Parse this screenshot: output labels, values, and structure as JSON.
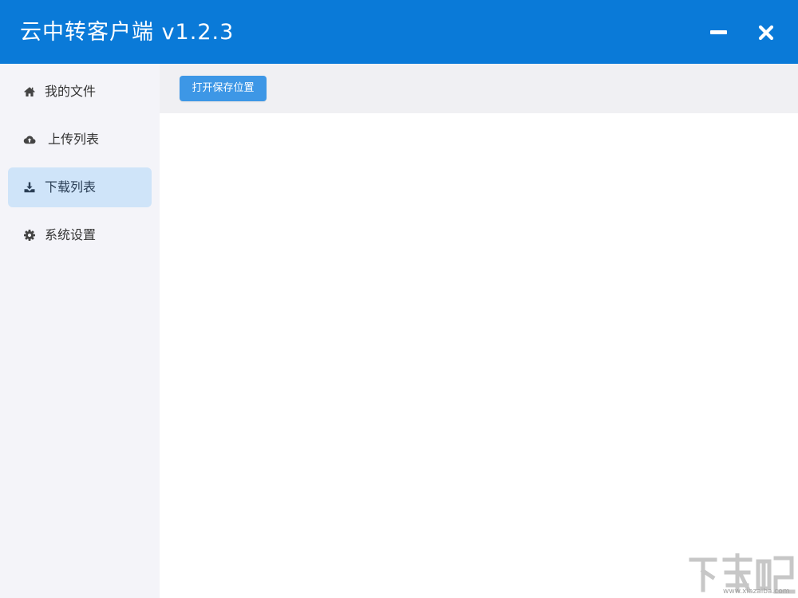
{
  "window": {
    "title": "云中转客户端 v1.2.3",
    "minimize_icon": "minimize-icon",
    "close_icon": "close-icon",
    "accent_color": "#0a7ad8"
  },
  "sidebar": {
    "items": [
      {
        "label": "我的文件",
        "icon": "home-icon",
        "active": false
      },
      {
        "label": "上传列表",
        "icon": "cloud-upload-icon",
        "active": false
      },
      {
        "label": "下载列表",
        "icon": "download-icon",
        "active": true
      },
      {
        "label": "系统设置",
        "icon": "gear-icon",
        "active": false
      }
    ]
  },
  "toolbar": {
    "open_location_label": "打开保存位置"
  },
  "watermark": {
    "logo": "下载吧",
    "url": "www.xiazaiba.com"
  }
}
